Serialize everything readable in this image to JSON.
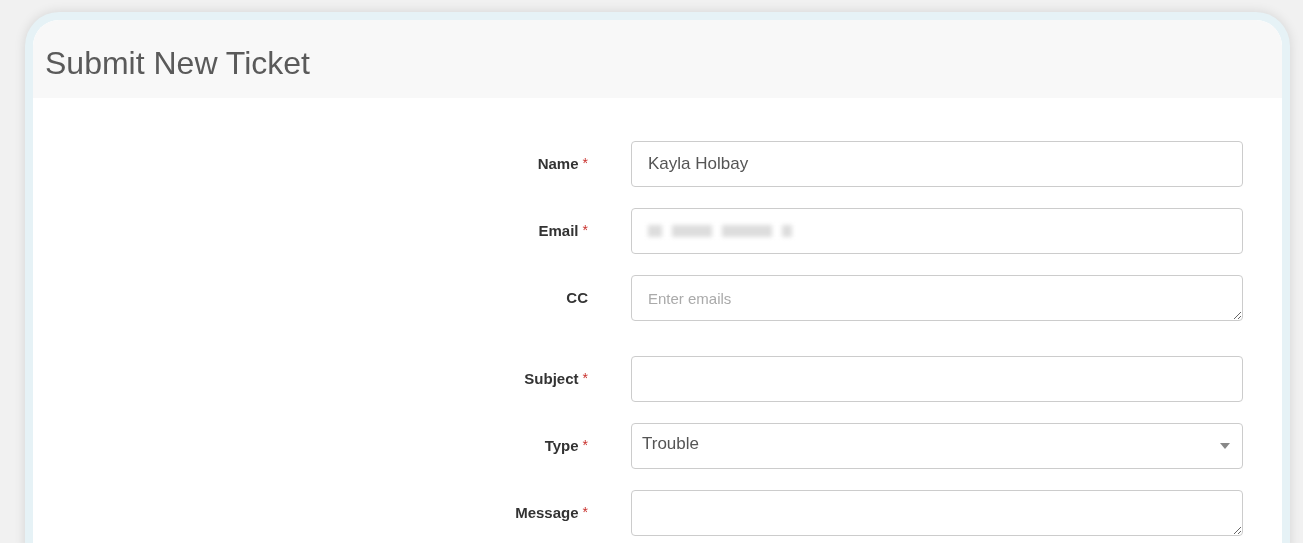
{
  "title": "Submit New Ticket",
  "fields": [
    {
      "kind": "input",
      "label": "Name",
      "required_mark": "*",
      "value": "Kayla Holbay"
    },
    {
      "kind": "input",
      "label": "Email",
      "required_mark": "*",
      "redacted": true
    },
    {
      "kind": "textarea",
      "label": "CC",
      "placeholder": "Enter emails"
    },
    {
      "kind": "input",
      "label": "Subject",
      "required_mark": "*"
    },
    {
      "kind": "select",
      "label": "Type",
      "required_mark": "*",
      "value": "Trouble"
    },
    {
      "kind": "textarea",
      "label": "Message",
      "required_mark": "*"
    }
  ]
}
